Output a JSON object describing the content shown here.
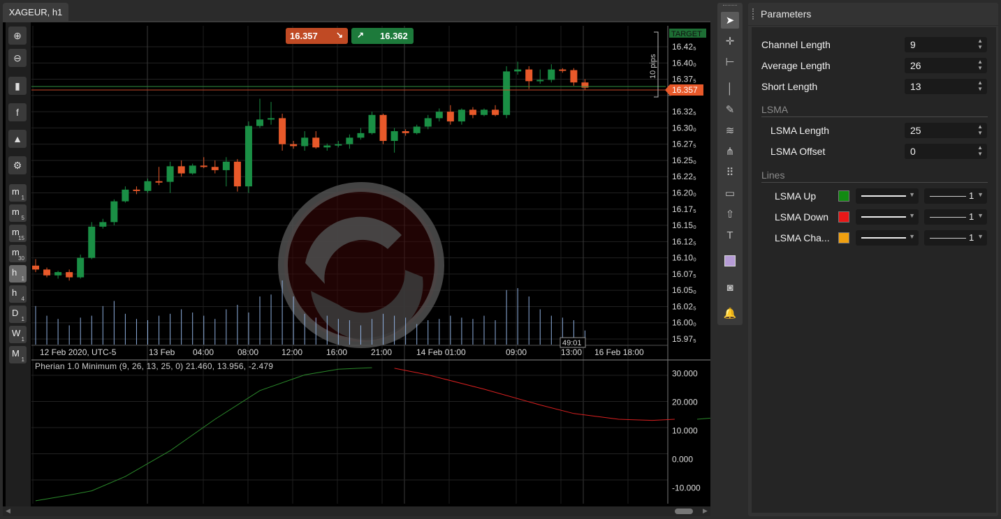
{
  "tab": {
    "title": "XAGEUR, h1"
  },
  "quote": {
    "sell": "16.357",
    "buy": "16.362",
    "target": "TARGET",
    "current_price": "16.357",
    "range_label": "10 pips"
  },
  "left_toolbar": {
    "timeframes": [
      {
        "main": "m",
        "sub": "1"
      },
      {
        "main": "m",
        "sub": "5"
      },
      {
        "main": "m",
        "sub": "15"
      },
      {
        "main": "m",
        "sub": "30"
      },
      {
        "main": "h",
        "sub": "1"
      },
      {
        "main": "h",
        "sub": "4"
      },
      {
        "main": "D",
        "sub": "1"
      },
      {
        "main": "W",
        "sub": "1"
      },
      {
        "main": "M",
        "sub": "1"
      }
    ],
    "active_timeframe": "h1"
  },
  "time_axis": {
    "labels": [
      "12 Feb 2020, UTC-5",
      "13 Feb",
      "04:00",
      "08:00",
      "12:00",
      "16:00",
      "21:00",
      "14 Feb 01:00",
      "09:00",
      "13:00",
      "16 Feb 18:00"
    ],
    "countdown": "49:01"
  },
  "price_axis": {
    "labels": [
      "16.42₅",
      "16.40₀",
      "16.37₅",
      "16.32₅",
      "16.30₀",
      "16.27₅",
      "16.25₀",
      "16.22₅",
      "16.20₀",
      "16.17₅",
      "16.15₀",
      "16.12₅",
      "16.10₀",
      "16.07₅",
      "16.05₀",
      "16.02₅",
      "16.00₀",
      "15.97₅"
    ]
  },
  "indicator": {
    "label": "Pherian 1.0 Minimum (9, 26, 13, 25, 0) 21.460, 13.956, -2.479",
    "axis_labels": [
      "30.000",
      "20.000",
      "10.000",
      "0.000",
      "-10.000"
    ]
  },
  "candles": [
    {
      "o": 16.088,
      "h": 16.098,
      "l": 16.078,
      "c": 16.082
    },
    {
      "o": 16.082,
      "h": 16.085,
      "l": 16.07,
      "c": 16.073
    },
    {
      "o": 16.073,
      "h": 16.08,
      "l": 16.068,
      "c": 16.078
    },
    {
      "o": 16.078,
      "h": 16.082,
      "l": 16.065,
      "c": 16.07
    },
    {
      "o": 16.07,
      "h": 16.105,
      "l": 16.068,
      "c": 16.1
    },
    {
      "o": 16.1,
      "h": 16.155,
      "l": 16.098,
      "c": 16.148
    },
    {
      "o": 16.148,
      "h": 16.16,
      "l": 16.145,
      "c": 16.155
    },
    {
      "o": 16.155,
      "h": 16.19,
      "l": 16.15,
      "c": 16.187
    },
    {
      "o": 16.187,
      "h": 16.21,
      "l": 16.185,
      "c": 16.205
    },
    {
      "o": 16.205,
      "h": 16.21,
      "l": 16.198,
      "c": 16.203
    },
    {
      "o": 16.203,
      "h": 16.222,
      "l": 16.2,
      "c": 16.218
    },
    {
      "o": 16.218,
      "h": 16.24,
      "l": 16.212,
      "c": 16.217
    },
    {
      "o": 16.217,
      "h": 16.248,
      "l": 16.2,
      "c": 16.241
    },
    {
      "o": 16.241,
      "h": 16.25,
      "l": 16.225,
      "c": 16.23
    },
    {
      "o": 16.23,
      "h": 16.245,
      "l": 16.228,
      "c": 16.242
    },
    {
      "o": 16.242,
      "h": 16.255,
      "l": 16.238,
      "c": 16.24
    },
    {
      "o": 16.24,
      "h": 16.25,
      "l": 16.23,
      "c": 16.235
    },
    {
      "o": 16.235,
      "h": 16.255,
      "l": 16.21,
      "c": 16.248
    },
    {
      "o": 16.248,
      "h": 16.252,
      "l": 16.202,
      "c": 16.21
    },
    {
      "o": 16.21,
      "h": 16.31,
      "l": 16.2,
      "c": 16.303
    },
    {
      "o": 16.303,
      "h": 16.345,
      "l": 16.3,
      "c": 16.313
    },
    {
      "o": 16.313,
      "h": 16.34,
      "l": 16.305,
      "c": 16.315
    },
    {
      "o": 16.315,
      "h": 16.322,
      "l": 16.265,
      "c": 16.275
    },
    {
      "o": 16.275,
      "h": 16.28,
      "l": 16.268,
      "c": 16.272
    },
    {
      "o": 16.272,
      "h": 16.295,
      "l": 16.265,
      "c": 16.285
    },
    {
      "o": 16.285,
      "h": 16.295,
      "l": 16.268,
      "c": 16.27
    },
    {
      "o": 16.27,
      "h": 16.276,
      "l": 16.265,
      "c": 16.273
    },
    {
      "o": 16.273,
      "h": 16.28,
      "l": 16.27,
      "c": 16.275
    },
    {
      "o": 16.275,
      "h": 16.29,
      "l": 16.268,
      "c": 16.285
    },
    {
      "o": 16.285,
      "h": 16.3,
      "l": 16.282,
      "c": 16.292
    },
    {
      "o": 16.292,
      "h": 16.325,
      "l": 16.29,
      "c": 16.32
    },
    {
      "o": 16.32,
      "h": 16.322,
      "l": 16.275,
      "c": 16.28
    },
    {
      "o": 16.28,
      "h": 16.3,
      "l": 16.262,
      "c": 16.295
    },
    {
      "o": 16.295,
      "h": 16.298,
      "l": 16.288,
      "c": 16.292
    },
    {
      "o": 16.292,
      "h": 16.305,
      "l": 16.29,
      "c": 16.302
    },
    {
      "o": 16.302,
      "h": 16.32,
      "l": 16.298,
      "c": 16.315
    },
    {
      "o": 16.315,
      "h": 16.33,
      "l": 16.31,
      "c": 16.325
    },
    {
      "o": 16.325,
      "h": 16.335,
      "l": 16.305,
      "c": 16.31
    },
    {
      "o": 16.31,
      "h": 16.33,
      "l": 16.305,
      "c": 16.328
    },
    {
      "o": 16.328,
      "h": 16.332,
      "l": 16.315,
      "c": 16.32
    },
    {
      "o": 16.32,
      "h": 16.33,
      "l": 16.318,
      "c": 16.328
    },
    {
      "o": 16.328,
      "h": 16.335,
      "l": 16.318,
      "c": 16.32
    },
    {
      "o": 16.32,
      "h": 16.395,
      "l": 16.315,
      "c": 16.387
    },
    {
      "o": 16.387,
      "h": 16.402,
      "l": 16.382,
      "c": 16.39
    },
    {
      "o": 16.39,
      "h": 16.395,
      "l": 16.36,
      "c": 16.372
    },
    {
      "o": 16.372,
      "h": 16.39,
      "l": 16.368,
      "c": 16.374
    },
    {
      "o": 16.374,
      "h": 16.398,
      "l": 16.37,
      "c": 16.39
    },
    {
      "o": 16.39,
      "h": 16.392,
      "l": 16.385,
      "c": 16.389
    },
    {
      "o": 16.389,
      "h": 16.392,
      "l": 16.365,
      "c": 16.37
    },
    {
      "o": 16.37,
      "h": 16.375,
      "l": 16.358,
      "c": 16.362
    }
  ],
  "volumes": [
    0.6,
    0.45,
    0.4,
    0.3,
    0.42,
    0.45,
    0.6,
    0.68,
    0.48,
    0.4,
    0.38,
    0.45,
    0.48,
    0.55,
    0.5,
    0.45,
    0.4,
    0.55,
    0.62,
    0.5,
    0.75,
    0.78,
    1.0,
    0.75,
    0.48,
    0.42,
    0.45,
    0.4,
    0.38,
    0.3,
    0.4,
    0.48,
    0.45,
    0.42,
    0.32,
    0.38,
    0.4,
    0.45,
    0.42,
    0.4,
    0.45,
    0.38,
    0.85,
    0.88,
    0.75,
    0.55,
    0.45,
    0.42,
    0.38,
    0.22
  ],
  "indicator_series": {
    "ylim": [
      -15,
      33
    ],
    "up": [
      [
        0,
        -14.5
      ],
      [
        3,
        -12.5
      ],
      [
        5,
        -11
      ],
      [
        8,
        -6
      ],
      [
        12,
        3
      ],
      [
        16,
        14
      ],
      [
        20,
        24
      ],
      [
        24,
        29.5
      ],
      [
        27,
        31.5
      ],
      [
        30,
        32
      ]
    ],
    "down": [
      [
        32,
        31.8
      ],
      [
        35,
        29.5
      ],
      [
        40,
        24.5
      ],
      [
        45,
        19
      ],
      [
        48,
        16
      ],
      [
        52,
        14
      ],
      [
        55,
        13.6
      ],
      [
        57,
        14
      ]
    ],
    "channel": [],
    "up2": [
      [
        59,
        14
      ],
      [
        62,
        15
      ],
      [
        66,
        17
      ],
      [
        70,
        19
      ],
      [
        73,
        21
      ],
      [
        76,
        21.5
      ]
    ]
  },
  "right_toolbar": {
    "icons": [
      "pointer-icon",
      "crosshair-icon",
      "measure-icon",
      "vertical-line-icon",
      "pen-icon",
      "fibonacci-icon",
      "pitchfork-icon",
      "grid-icon",
      "rectangle-icon",
      "arrow-up-shape-icon",
      "text-icon",
      "color-swatch-icon",
      "camera-icon",
      "bell-icon"
    ]
  },
  "params": {
    "title": "Parameters",
    "channel_length": {
      "label": "Channel Length",
      "value": "9"
    },
    "average_length": {
      "label": "Average Length",
      "value": "26"
    },
    "short_length": {
      "label": "Short Length",
      "value": "13"
    },
    "lsma_section": "LSMA",
    "lsma_length": {
      "label": "LSMA Length",
      "value": "25"
    },
    "lsma_offset": {
      "label": "LSMA Offset",
      "value": "0"
    },
    "lines_section": "Lines",
    "lsma_up": {
      "label": "LSMA Up",
      "color": "#128a12",
      "width": "1"
    },
    "lsma_down": {
      "label": "LSMA Down",
      "color": "#e81818",
      "width": "1"
    },
    "lsma_channel": {
      "label": "LSMA Cha...",
      "color": "#f0a010",
      "width": "1"
    }
  },
  "colors": {
    "up": "#1a8f45",
    "down": "#e8592a",
    "volume": "#8fb0e0",
    "ind_up": "#2b8a2b",
    "ind_down": "#d92020"
  }
}
